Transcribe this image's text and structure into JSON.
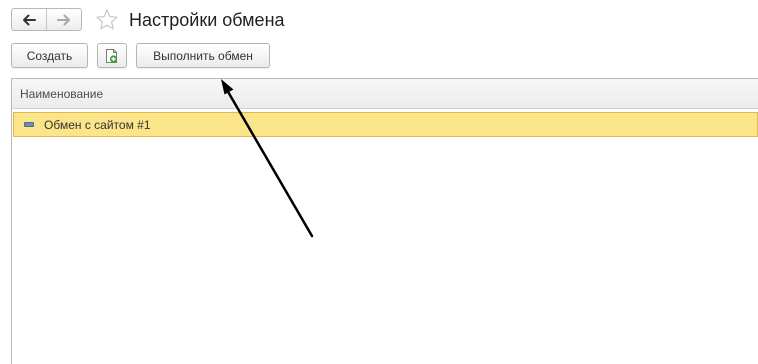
{
  "header": {
    "title": "Настройки обмена",
    "back_icon": "arrow-left-icon",
    "forward_icon": "arrow-right-icon",
    "favorite_icon": "star-icon"
  },
  "toolbar": {
    "create_label": "Создать",
    "add_icon": "document-add-icon",
    "exchange_label": "Выполнить обмен"
  },
  "table": {
    "columns": [
      "Наименование"
    ],
    "rows": [
      {
        "name": "Обмен с сайтом #1",
        "selected": true
      }
    ]
  },
  "colors": {
    "selection_fill": "#fbe58a",
    "selection_border": "#e2b84a",
    "annotation_arrow": "#000000"
  }
}
